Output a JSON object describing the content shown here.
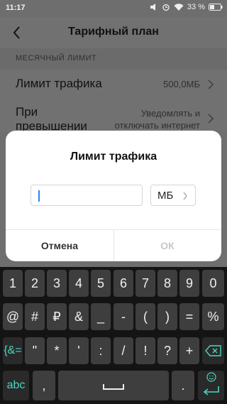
{
  "status": {
    "time": "11:17",
    "battery_pct": "33 %"
  },
  "header": {
    "title": "Тарифный план"
  },
  "section": {
    "label": "МЕСЯЧНЫЙ ЛИМИТ"
  },
  "rows": [
    {
      "label": "Лимит трафика",
      "value": "500,0МБ"
    },
    {
      "label_line1": "При",
      "label_line2": "превышении",
      "value_line1": "Уведомлять и",
      "value_line2": "отключать интернет"
    }
  ],
  "dialog": {
    "title": "Лимит трафика",
    "input_value": "",
    "unit": "МБ",
    "cancel_label": "Отмена",
    "ok_label": "ОК"
  },
  "keyboard": {
    "row1": [
      "1",
      "2",
      "3",
      "4",
      "5",
      "6",
      "7",
      "8",
      "9",
      "0"
    ],
    "row2": [
      "@",
      "#",
      "₽",
      "&",
      "_",
      "-",
      "(",
      ")",
      "=",
      "%"
    ],
    "row3": [
      "{&=",
      "\"",
      "*",
      "'",
      ":",
      "/",
      "!",
      "?",
      "+"
    ],
    "row4": {
      "abc": "abc",
      "comma": ",",
      "period": "."
    }
  },
  "colors": {
    "accent": "#2a86f3",
    "keyboard_bg": "#141414",
    "key_bg": "#3e3e3e",
    "accent_key": "#4ad6c3"
  }
}
